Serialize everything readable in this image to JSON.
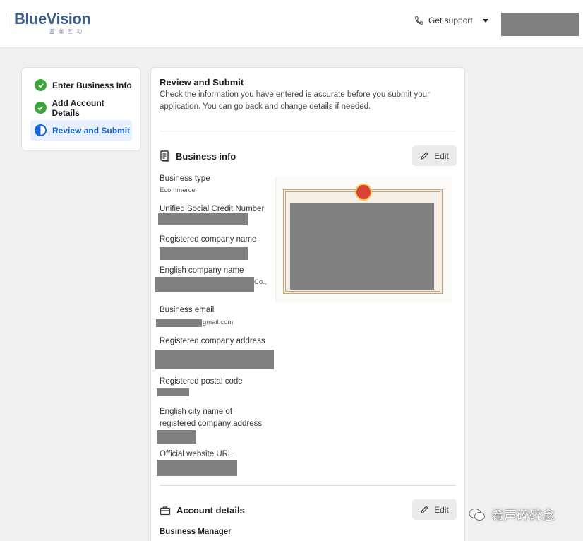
{
  "header": {
    "logo": "BlueVision",
    "logo_sub": "蓝 瀚 互 动",
    "support_label": "Get support"
  },
  "steps": [
    {
      "label": "Enter Business Info",
      "state": "done"
    },
    {
      "label": "Add Account Details",
      "state": "done"
    },
    {
      "label": "Review and Submit",
      "state": "current"
    }
  ],
  "main": {
    "title": "Review and Submit",
    "description": "Check the information you have entered is accurate before you submit your application. You can go back and change details if needed.",
    "business_info": {
      "heading": "Business info",
      "edit_label": "Edit",
      "fields": {
        "business_type_label": "Business type",
        "business_type_value": "Ecommerce",
        "uscn_label": "Unified Social Credit Number",
        "registered_name_label": "Registered company name",
        "english_name_label": "English company name",
        "english_name_suffix": "Co.,",
        "business_email_label": "Business email",
        "business_email_suffix": "gmail.com",
        "address_label": "Registered company address",
        "postal_label": "Registered postal code",
        "city_label_line1": "English city name of",
        "city_label_line2": "registered company address",
        "website_label": "Official website URL"
      }
    },
    "account_details": {
      "heading": "Account details",
      "edit_label": "Edit",
      "business_manager_label": "Business Manager"
    }
  },
  "watermark": "希声碎碎念",
  "colors": {
    "accent": "#1b63d6",
    "check": "#3aa53b",
    "redaction": "#808080"
  }
}
